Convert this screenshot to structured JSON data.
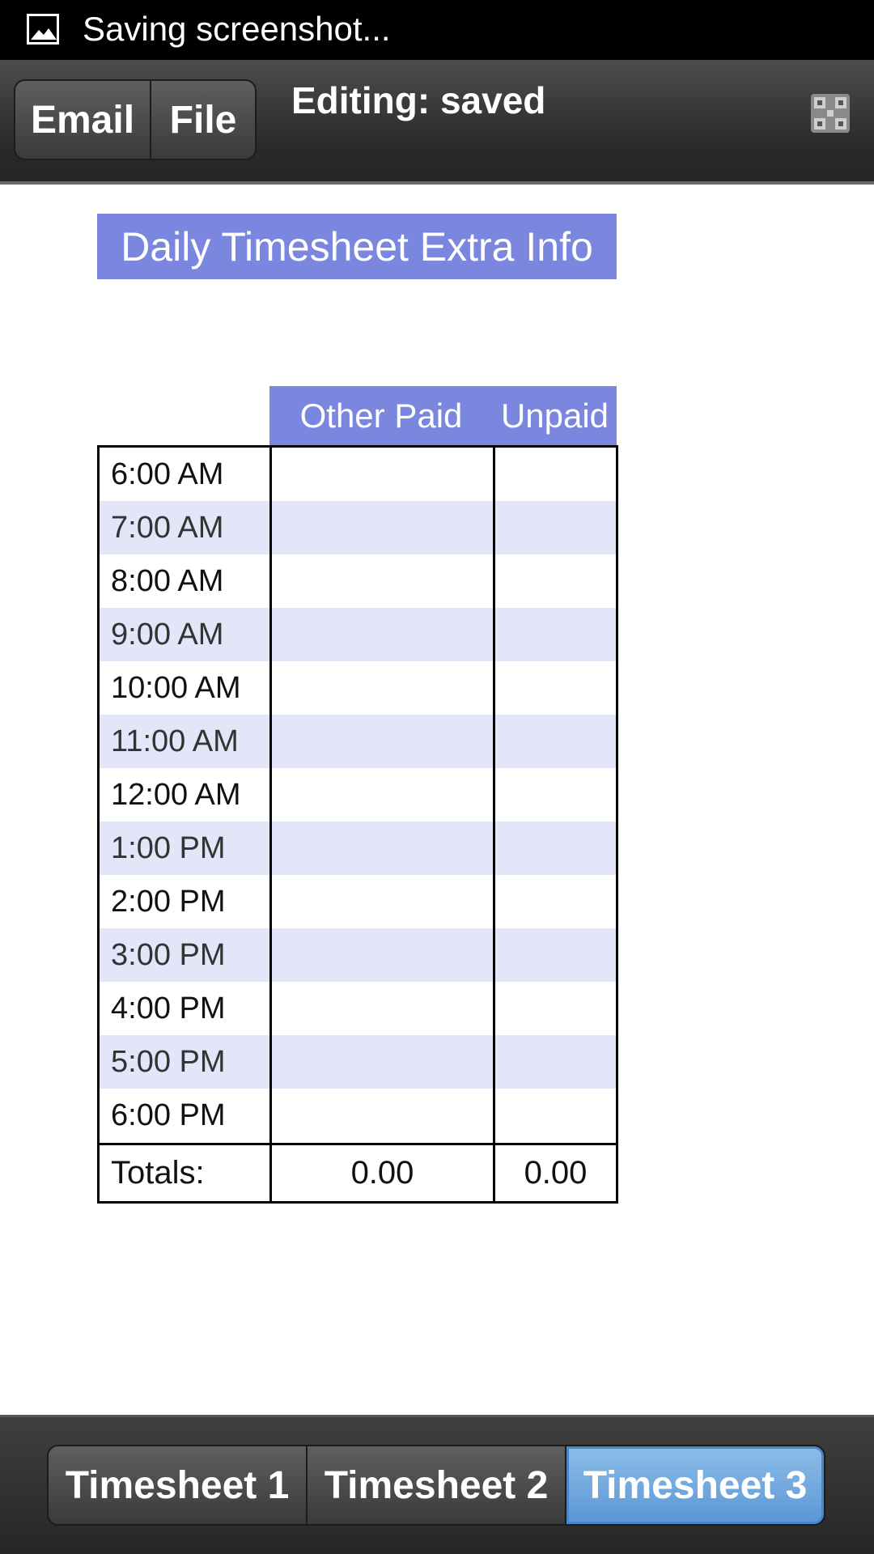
{
  "status_bar": {
    "text": "Saving screenshot...",
    "icon": "image-icon"
  },
  "action_bar": {
    "email_label": "Email",
    "file_label": "File",
    "editing_status": "Editing: saved",
    "qr_icon": "qr-code-icon"
  },
  "sheet": {
    "title": "Daily Timesheet Extra Info",
    "columns": [
      "Other Paid",
      "Unpaid"
    ],
    "rows": [
      {
        "time": "6:00 AM",
        "other_paid": "",
        "unpaid": ""
      },
      {
        "time": "7:00 AM",
        "other_paid": "",
        "unpaid": ""
      },
      {
        "time": "8:00 AM",
        "other_paid": "",
        "unpaid": ""
      },
      {
        "time": "9:00 AM",
        "other_paid": "",
        "unpaid": ""
      },
      {
        "time": "10:00 AM",
        "other_paid": "",
        "unpaid": ""
      },
      {
        "time": "11:00 AM",
        "other_paid": "",
        "unpaid": ""
      },
      {
        "time": "12:00 AM",
        "other_paid": "",
        "unpaid": ""
      },
      {
        "time": "1:00 PM",
        "other_paid": "",
        "unpaid": ""
      },
      {
        "time": "2:00 PM",
        "other_paid": "",
        "unpaid": ""
      },
      {
        "time": "3:00 PM",
        "other_paid": "",
        "unpaid": ""
      },
      {
        "time": "4:00 PM",
        "other_paid": "",
        "unpaid": ""
      },
      {
        "time": "5:00 PM",
        "other_paid": "",
        "unpaid": ""
      },
      {
        "time": "6:00 PM",
        "other_paid": "",
        "unpaid": ""
      }
    ],
    "totals_label": "Totals:",
    "totals": {
      "other_paid": "0.00",
      "unpaid": "0.00"
    }
  },
  "tabs": [
    {
      "label": "Timesheet 1",
      "active": false
    },
    {
      "label": "Timesheet 2",
      "active": false
    },
    {
      "label": "Timesheet 3",
      "active": true
    }
  ],
  "colors": {
    "header_blue": "#7b86df",
    "row_shade": "#e3e5f8",
    "active_tab": "#6ea8de"
  }
}
